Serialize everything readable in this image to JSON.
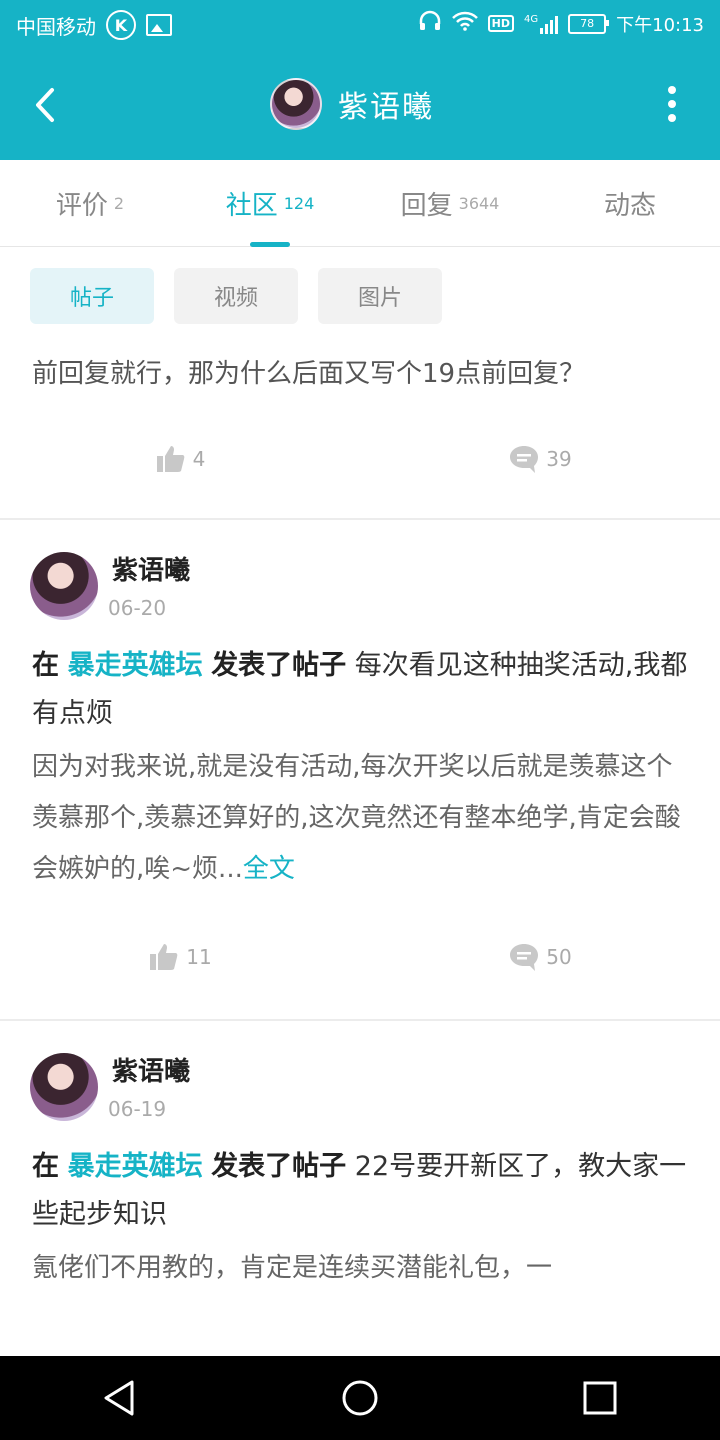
{
  "status_bar": {
    "carrier": "中国移动",
    "k_badge": "K",
    "network": "4G",
    "hd": "HD",
    "battery": "78",
    "time": "下午10:13",
    "icons": [
      "k-icon",
      "image-icon",
      "headset-icon",
      "wifi-icon",
      "hd-icon",
      "signal-icon",
      "battery-icon"
    ]
  },
  "header": {
    "title": "紫语曦",
    "back_icon": "chevron-left-icon",
    "more_icon": "more-vertical-icon",
    "background": "#16b3c6"
  },
  "tabs": [
    {
      "label": "评价",
      "count": "2"
    },
    {
      "label": "社区",
      "count": "124",
      "active": true
    },
    {
      "label": "回复",
      "count": "3644"
    },
    {
      "label": "动态",
      "count": ""
    }
  ],
  "filters": [
    {
      "label": "帖子",
      "active": true
    },
    {
      "label": "视频"
    },
    {
      "label": "图片"
    }
  ],
  "posts": [
    {
      "partial": true,
      "body": "前回复就行，那为什么后面又写个19点前回复？",
      "likes": "4",
      "comments": "39"
    },
    {
      "author": "紫语曦",
      "date": "06-20",
      "prefix": "在",
      "forum": "暴走英雄坛",
      "action": "发表了帖子",
      "title": "每次看见这种抽奖活动,我都有点烦",
      "text": "因为对我来说,就是没有活动,每次开奖以后就是羡慕这个羡慕那个,羡慕还算好的,这次竟然还有整本绝学,肯定会酸会嫉妒的,唉~烦...",
      "more": "全文",
      "likes": "11",
      "comments": "50"
    },
    {
      "author": "紫语曦",
      "date": "06-19",
      "prefix": "在",
      "forum": "暴走英雄坛",
      "action": "发表了帖子",
      "title": "22号要开新区了，教大家一些起步知识",
      "text": "氪佬们不用教的，肯定是连续买潜能礼包，一"
    }
  ],
  "navbar": {
    "icons": [
      "back-triangle-icon",
      "home-circle-icon",
      "recents-square-icon"
    ]
  }
}
